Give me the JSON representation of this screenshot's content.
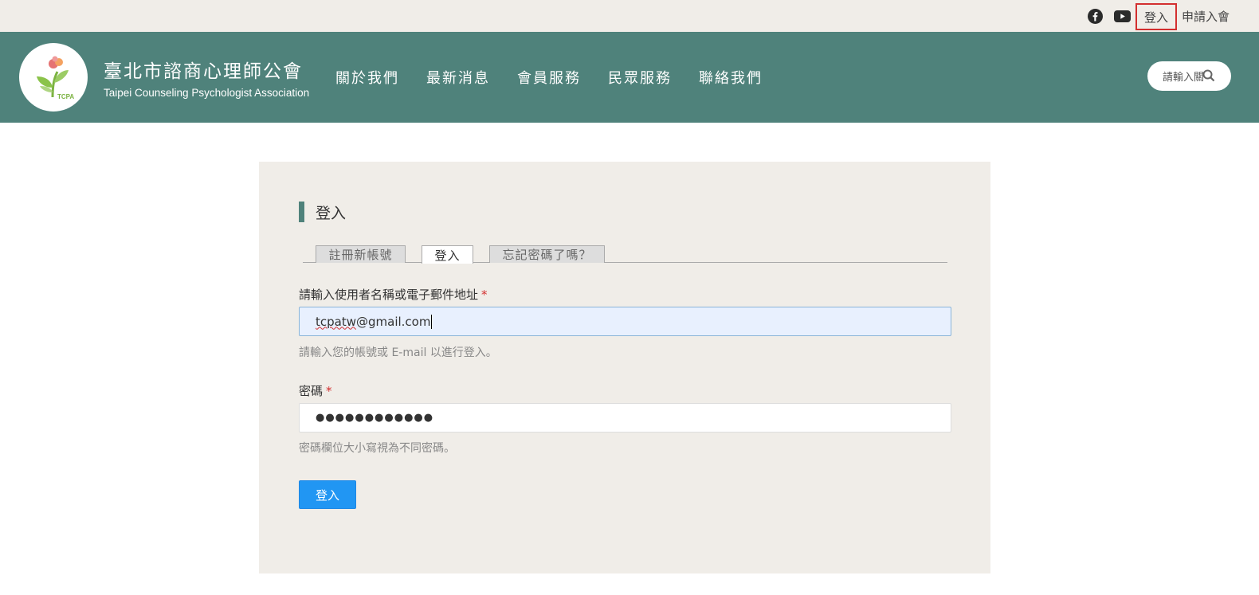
{
  "topbar": {
    "social": [
      {
        "name": "facebook-icon"
      },
      {
        "name": "youtube-icon"
      }
    ],
    "login_label": "登入",
    "join_label": "申請入會"
  },
  "header": {
    "brand_zh": "臺北市諮商心理師公會",
    "brand_en": "Taipei Counseling Psychologist Association",
    "logo_text": "TCPA",
    "nav": [
      {
        "label": "關於我們"
      },
      {
        "label": "最新消息"
      },
      {
        "label": "會員服務"
      },
      {
        "label": "民眾服務"
      },
      {
        "label": "聯絡我們"
      }
    ],
    "search_placeholder": "請輸入關",
    "accent_color": "#4f827b"
  },
  "login": {
    "title": "登入",
    "tabs": [
      {
        "label": "註冊新帳號",
        "active": false
      },
      {
        "label": "登入",
        "active": true
      },
      {
        "label": "忘記密碼了嗎？",
        "active": false
      }
    ],
    "username": {
      "label": "請輸入使用者名稱或電子郵件地址",
      "required_mark": "*",
      "value_underlined": "tcpatw",
      "value_rest": "@gmail.com",
      "hint": "請輸入您的帳號或 E-mail 以進行登入。"
    },
    "password": {
      "label": "密碼",
      "required_mark": "*",
      "masked_value": "●●●●●●●●●●●●",
      "hint": "密碼欄位大小寫視為不同密碼。"
    },
    "submit_label": "登入",
    "submit_color": "#2196f3"
  }
}
